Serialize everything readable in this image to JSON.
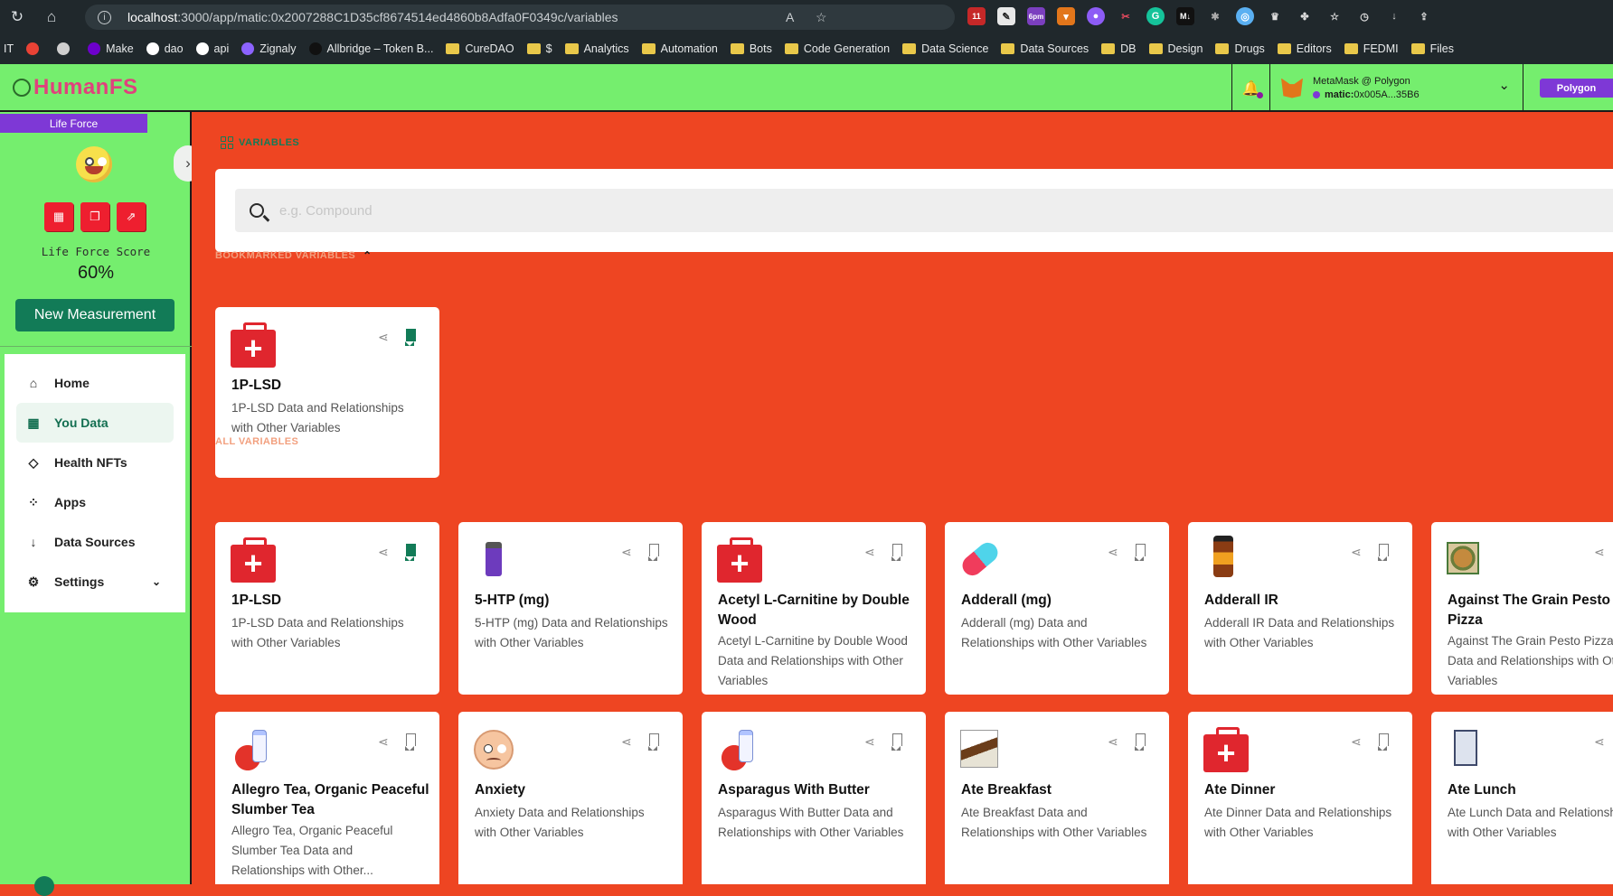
{
  "browser": {
    "url_host": "localhost",
    "url_rest": ":3000/app/matic:0x2007288C1D35cf8674514ed4860b8Adfa0F0349c/variables",
    "calendar_badge": "11",
    "time_badge": "6pm",
    "bookmarks": [
      {
        "label": "IT",
        "type": "text"
      },
      {
        "label": "",
        "type": "g"
      },
      {
        "label": "",
        "type": "x"
      },
      {
        "label": "Make",
        "type": "make"
      },
      {
        "label": "dao",
        "type": "gh"
      },
      {
        "label": "api",
        "type": "gh"
      },
      {
        "label": "Zignaly",
        "type": "z"
      },
      {
        "label": "Allbridge – Token B...",
        "type": "ab"
      },
      {
        "label": "CureDAO",
        "type": "folder"
      },
      {
        "label": "$",
        "type": "folder"
      },
      {
        "label": "Analytics",
        "type": "folder"
      },
      {
        "label": "Automation",
        "type": "folder"
      },
      {
        "label": "Bots",
        "type": "folder"
      },
      {
        "label": "Code Generation",
        "type": "folder"
      },
      {
        "label": "Data Science",
        "type": "folder"
      },
      {
        "label": "Data Sources",
        "type": "folder"
      },
      {
        "label": "DB",
        "type": "folder"
      },
      {
        "label": "Design",
        "type": "folder"
      },
      {
        "label": "Drugs",
        "type": "folder"
      },
      {
        "label": "Editors",
        "type": "folder"
      },
      {
        "label": "FEDMI",
        "type": "folder"
      },
      {
        "label": "Files",
        "type": "folder"
      }
    ]
  },
  "header": {
    "logo_text": "HumanFS",
    "wallet_name": "MetaMask @ Polygon",
    "wallet_prefix": "matic:",
    "wallet_address": "0x005A...35B6",
    "network": "Polygon"
  },
  "sidebar": {
    "badge": "Life Force",
    "score_label": "Life Force Score",
    "score_value": "60%",
    "new_measurement": "New Measurement",
    "nav": [
      {
        "label": "Home",
        "icon": "home-icon"
      },
      {
        "label": "You Data",
        "icon": "grid-icon",
        "active": true
      },
      {
        "label": "Health NFTs",
        "icon": "diamond-icon"
      },
      {
        "label": "Apps",
        "icon": "apps-icon"
      },
      {
        "label": "Data Sources",
        "icon": "arrow-down-icon"
      },
      {
        "label": "Settings",
        "icon": "gear-icon"
      }
    ]
  },
  "main": {
    "breadcrumb": "VARIABLES",
    "search_placeholder": "e.g. Compound",
    "bookmarked_title": "BOOKMARKED VARIABLES",
    "all_title": "ALL VARIABLES",
    "bookmarked": [
      {
        "name": "1P-LSD",
        "desc": "1P-LSD Data and Relationships with Other Variables",
        "icon": "first-aid-kit-icon",
        "bookmarked": true
      }
    ],
    "variables": [
      {
        "name": "1P-LSD",
        "desc": "1P-LSD Data and Relationships with Other Variables",
        "icon": "first-aid-kit-icon",
        "bookmarked": true
      },
      {
        "name": "5-HTP (mg)",
        "desc": "5-HTP (mg) Data and Relationships with Other Variables",
        "icon": "supplement-bottle-icon",
        "bookmarked": false
      },
      {
        "name": "Acetyl L-Carnitine by Double Wood",
        "desc": "Acetyl L-Carnitine by Double Wood Data and Relationships with Other Variables",
        "icon": "first-aid-kit-icon",
        "bookmarked": false
      },
      {
        "name": "Adderall (mg)",
        "desc": "Adderall (mg) Data and Relationships with Other Variables",
        "icon": "pill-icon",
        "bookmarked": false
      },
      {
        "name": "Adderall IR",
        "desc": "Adderall IR Data and Relationships with Other Variables",
        "icon": "medicine-bottle-icon",
        "bookmarked": false
      },
      {
        "name": "Against The Grain Pesto Pizza",
        "desc": "Against The Grain Pesto Pizza Data and Relationships with Other Variables",
        "icon": "pizza-box-icon",
        "bookmarked": false
      },
      {
        "name": "Allegro Tea, Organic Peaceful Slumber Tea",
        "desc": "Allegro Tea, Organic Peaceful Slumber Tea Data and Relationships with Other...",
        "icon": "tomato-milk-icon",
        "bookmarked": false
      },
      {
        "name": "Anxiety",
        "desc": "Anxiety Data and Relationships with Other Variables",
        "icon": "anxious-face-icon",
        "bookmarked": false
      },
      {
        "name": "Asparagus With Butter",
        "desc": "Asparagus With Butter Data and Relationships with Other Variables",
        "icon": "tomato-milk-icon",
        "bookmarked": false
      },
      {
        "name": "Ate Breakfast",
        "desc": "Ate Breakfast Data and Relationships with Other Variables",
        "icon": "bar-box-icon",
        "bookmarked": false
      },
      {
        "name": "Ate Dinner",
        "desc": "Ate Dinner Data and Relationships with Other Variables",
        "icon": "first-aid-kit-icon",
        "bookmarked": false
      },
      {
        "name": "Ate Lunch",
        "desc": "Ate Lunch Data and Relationships with Other Variables",
        "icon": "book-icon",
        "bookmarked": false
      }
    ]
  }
}
